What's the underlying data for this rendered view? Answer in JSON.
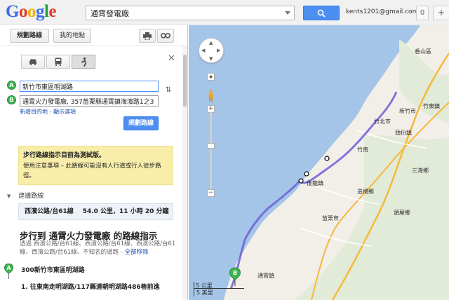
{
  "header": {
    "logo_letters": [
      {
        "ch": "G",
        "color": "#3b6ee8"
      },
      {
        "ch": "o",
        "color": "#e23d28"
      },
      {
        "ch": "o",
        "color": "#f4b400"
      },
      {
        "ch": "g",
        "color": "#3b6ee8"
      },
      {
        "ch": "l",
        "color": "#1fa040"
      },
      {
        "ch": "e",
        "color": "#e23d28"
      }
    ],
    "search_query": "通霄發電廠",
    "user_email": "kents1201@gmail.com",
    "notification_count": "0",
    "plus_label": "+"
  },
  "panel": {
    "tab_directions": "規劃路線",
    "tab_my_places": "我的地點",
    "waypoint_a_label": "A",
    "waypoint_a_value": "新竹市東區明湖路",
    "waypoint_b_label": "B",
    "waypoint_b_value": "通霄火力發電廠, 357苗栗縣通霄鎮海濱路1之3",
    "add_destination_link": "新增目的地",
    "separator": " - ",
    "show_options_link": "顯示選項",
    "get_directions_button": "規劃路線",
    "warning_title": "步行路線指示目前為測試版。",
    "warning_body": "使用注意事項 – 此路線可能沒有人行道或行人徒步路徑。",
    "suggested_routes_heading": "建議路線",
    "route_name": "西濱公路/台61線",
    "route_distance": "54.0 公里",
    "route_duration": "，11 小時 20 分鐘",
    "directions_title": "步行到 通霄火力發電廠 的路線指示",
    "via_text": "透過 西濱公路/台61線、西濱公路/台61線、西濱公路/台61線、西濱公路/台61線、不知名的道路 -",
    "remove_all_link": "全部移除",
    "start_address": "300新竹市東區明湖路",
    "step_1": "1. 往東南走明湖路/117縣道朝明湖路486巷前進"
  },
  "map": {
    "scale_km": "5 公里",
    "scale_mi": "5 英里",
    "marker_label": "B",
    "place_labels": [
      "竹北市",
      "新竹市",
      "竹東鎮",
      "香山區",
      "頭份鎮",
      "苗栗市",
      "三灣鄉",
      "後龍鎮",
      "通霄鎮",
      "造橋鄉",
      "頭屋鄉",
      "竹南"
    ],
    "colors": {
      "sea": "#a4c4e8",
      "land": "#f2efe9",
      "highway": "#f6b83c",
      "route": "#6f5fd6"
    }
  }
}
